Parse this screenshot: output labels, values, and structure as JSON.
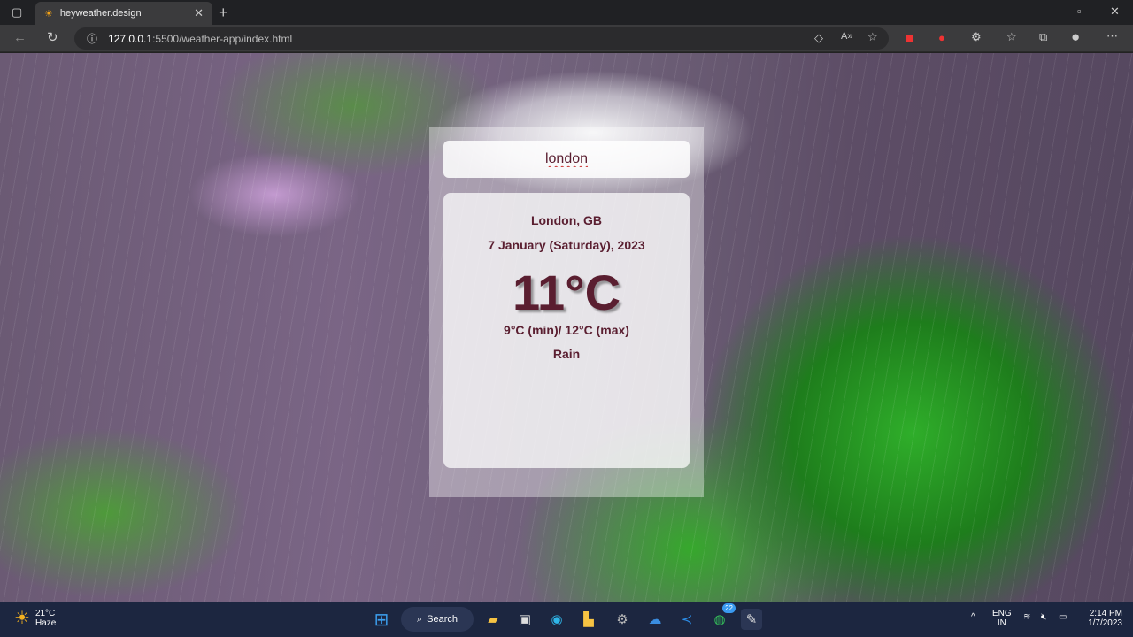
{
  "browser": {
    "tab_title": "heyweather.design",
    "url_host": "127.0.0.1",
    "url_path": ":5500/weather-app/index.html"
  },
  "app": {
    "search_value": "london",
    "city": "London, GB",
    "date": "7 January (Saturday), 2023",
    "temp": "11°C",
    "range": "9°C (min)/ 12°C (max)",
    "condition": "Rain"
  },
  "taskbar": {
    "weather_temp": "21°C",
    "weather_desc": "Haze",
    "search_label": "Search",
    "whatsapp_badge": "22",
    "lang": "ENG",
    "region": "IN",
    "time": "2:14 PM",
    "date": "1/7/2023"
  }
}
